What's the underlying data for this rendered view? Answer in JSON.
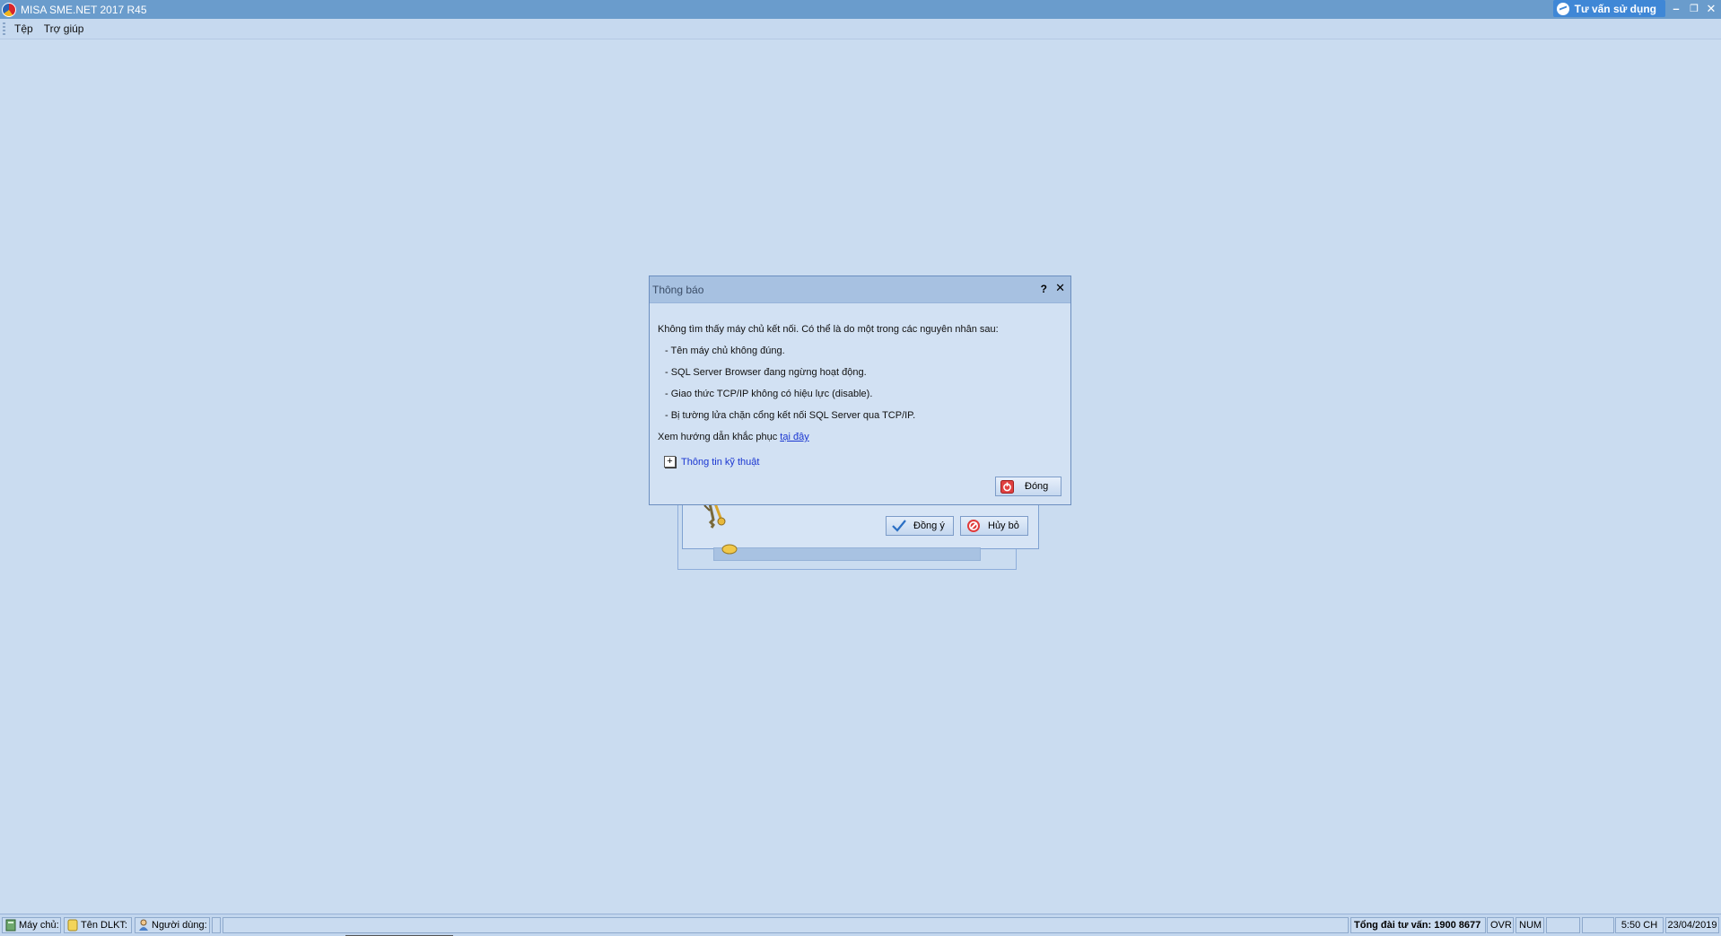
{
  "window": {
    "title": "MISA SME.NET 2017 R45",
    "support_button": "Tư vấn sử dụng",
    "minimize": "–",
    "restore": "❐",
    "close": "✕"
  },
  "menu": {
    "items": [
      "Tệp",
      "Trợ giúp"
    ]
  },
  "background_form": {
    "ok_label": "Đồng ý",
    "cancel_label": "Hủy bỏ"
  },
  "dialog": {
    "title": "Thông báo",
    "help": "?",
    "close": "✕",
    "message": "Không tìm thấy máy chủ kết nối. Có thể là do một trong các nguyên nhân sau:",
    "reasons": [
      "- Tên máy chủ không đúng.",
      "- SQL Server Browser đang ngừng hoạt động.",
      "- Giao thức TCP/IP không có hiệu lực (disable).",
      "- Bị tường lửa chặn cổng kết nối SQL Server qua TCP/IP."
    ],
    "guide_prefix": "Xem hướng dẫn khắc phục",
    "guide_link": "tại đây",
    "tech_info_toggle": "+",
    "tech_info_label": "Thông tin kỹ thuật",
    "close_button": "Đóng"
  },
  "statusbar": {
    "server_label": "Máy chủ:",
    "db_label": "Tên DLKT:",
    "user_label": "Người dùng:",
    "hotline": "Tổng đài tư vấn: 1900 8677",
    "ovr": "OVR",
    "num": "NUM",
    "time": "5:50 CH",
    "date": "23/04/2019"
  },
  "colors": {
    "desktop": "#cadcf0",
    "titlebar": "#6a9ccc",
    "support_button": "#3f87d6",
    "link": "#1a36d1"
  }
}
